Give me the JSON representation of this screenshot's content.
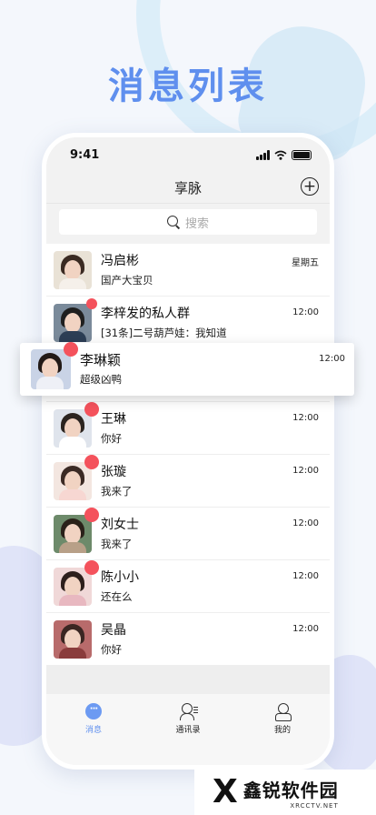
{
  "headline": "消息列表",
  "status_bar": {
    "time": "9:41"
  },
  "nav": {
    "title": "享脉",
    "add_icon": "plus-circle-icon"
  },
  "search": {
    "placeholder": "搜索"
  },
  "conversations": [
    {
      "name": "冯启彬",
      "message": "国产大宝贝",
      "time": "星期五",
      "unread": false
    },
    {
      "name": "李梓发的私人群",
      "message": "[31条]二号葫芦娃：我知道",
      "time": "12:00",
      "unread": true
    },
    {
      "name": "李琳颖",
      "message": "超级凶鸭",
      "time": "12:00",
      "unread": true
    },
    {
      "name": "王琳",
      "message": "你好",
      "time": "12:00",
      "unread": true
    },
    {
      "name": "张璇",
      "message": "我来了",
      "time": "12:00",
      "unread": true
    },
    {
      "name": "刘女士",
      "message": "我来了",
      "time": "12:00",
      "unread": true
    },
    {
      "name": "陈小小",
      "message": "还在么",
      "time": "12:00",
      "unread": true
    },
    {
      "name": "吴晶",
      "message": "你好",
      "time": "12:00",
      "unread": false
    }
  ],
  "tabs": [
    {
      "label": "消息",
      "icon": "chat-bubble-icon",
      "active": true
    },
    {
      "label": "通讯录",
      "icon": "contacts-icon",
      "active": false
    },
    {
      "label": "我的",
      "icon": "profile-icon",
      "active": false
    }
  ],
  "watermark": {
    "logo": "X",
    "title": "鑫锐软件园",
    "subtitle": "XRCCTV.NET"
  },
  "colors": {
    "accent": "#5f8fee",
    "badge": "#f4525c"
  }
}
